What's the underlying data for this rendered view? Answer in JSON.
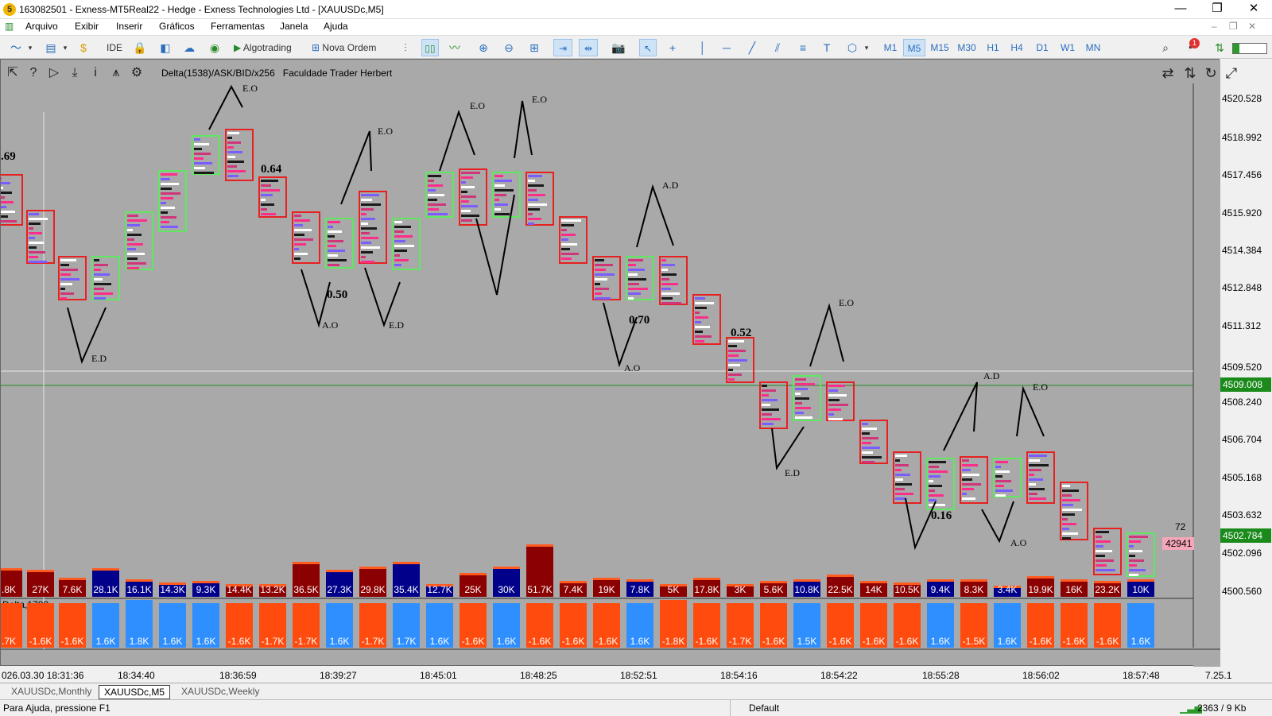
{
  "window": {
    "title": "163082501 - Exness-MT5Real22 - Hedge - Exness Technologies Ltd - [XAUUSDc,M5]",
    "app_icon": "5",
    "minimize": "—",
    "restore": "❐",
    "close": "✕"
  },
  "menu": [
    "Arquivo",
    "Exibir",
    "Inserir",
    "Gráficos",
    "Ferramentas",
    "Janela",
    "Ajuda"
  ],
  "toolbar": {
    "ide": "IDE",
    "algotrading": "Algotrading",
    "nova_ordem": "Nova Ordem",
    "timeframes": [
      "M1",
      "M5",
      "M15",
      "M30",
      "H1",
      "H4",
      "D1",
      "W1",
      "MN"
    ],
    "selected_timeframe": "M5",
    "notification_count": "1"
  },
  "chart": {
    "indicator_label": "Delta(1538)/ASK/BID/x256",
    "author_label": "Faculdade Trader Herbert",
    "delta_label": "Delta,1788",
    "price_labels": [
      "4520.528",
      "4518.992",
      "4517.456",
      "4515.920",
      "4514.384",
      "4512.848",
      "4511.312",
      "4509.520",
      "4508.240",
      "4506.704",
      "4505.168",
      "4503.632",
      "4502.096",
      "4500.560"
    ],
    "current_price": "4502.784",
    "line_price": "4509.008",
    "side_value_top": "72",
    "side_value_box": "42941",
    "time_labels": [
      "026.03.30 18:31:36",
      "18:34:40",
      "18:36:59",
      "18:39:27",
      "18:45:01",
      "18:48:25",
      "18:52:51",
      "18:54:16",
      "18:54:22",
      "18:55:28",
      "18:56:02",
      "18:57:48"
    ],
    "right_axis_bottom": "7.25.1",
    "volume_labels": [
      ".8K",
      "27K",
      "7.6K",
      "28.1K",
      "16.1K",
      "14.3K",
      "9.3K",
      "14.4K",
      "13.2K",
      "36.5K",
      "27.3K",
      "29.8K",
      "35.4K",
      "12.7K",
      "25K",
      "30K",
      "51.7K",
      "7.4K",
      "19K",
      "7.8K",
      "5K",
      "17.8K",
      "3K",
      "5.6K",
      "10.8K",
      "22.5K",
      "14K",
      "10.5K",
      "9.4K",
      "8.3K",
      "3.4K",
      "19.9K",
      "16K",
      "23.2K",
      "10K"
    ],
    "delta_labels": [
      ".7K",
      "-1.6K",
      "-1.6K",
      "1.6K",
      "1.8K",
      "1.6K",
      "1.6K",
      "-1.6K",
      "-1.7K",
      "-1.7K",
      "1.6K",
      "-1.7K",
      "1.7K",
      "1.6K",
      "-1.6K",
      "1.6K",
      "-1.6K",
      "-1.6K",
      "-1.6K",
      "1.6K",
      "-1.8K",
      "-1.6K",
      "-1.7K",
      "-1.6K",
      "1.5K",
      "-1.6K",
      "-1.6K",
      "-1.6K",
      "1.6K",
      "-1.5K",
      "1.6K",
      "-1.6K",
      "-1.6K",
      "-1.6K",
      "1.6K"
    ],
    "annotations": [
      "E.O",
      "E.O",
      "E.O",
      "E.O",
      "E.D",
      "A.O",
      "E.D",
      "A.D",
      "A.O",
      "E.O",
      "E.D",
      "A.D",
      "E.O",
      "A.O",
      ".69",
      "0.64",
      "0.50",
      "0.70",
      "0.52",
      "0.16"
    ]
  },
  "tabs": [
    "XAUUSDc,Monthly",
    "XAUUSDc,M5",
    "XAUUSDc,Weekly"
  ],
  "active_tab": "XAUUSDc,M5",
  "status": {
    "help": "Para Ajuda, pressione F1",
    "profile": "Default",
    "connection": "2363 / 9 Kb"
  }
}
